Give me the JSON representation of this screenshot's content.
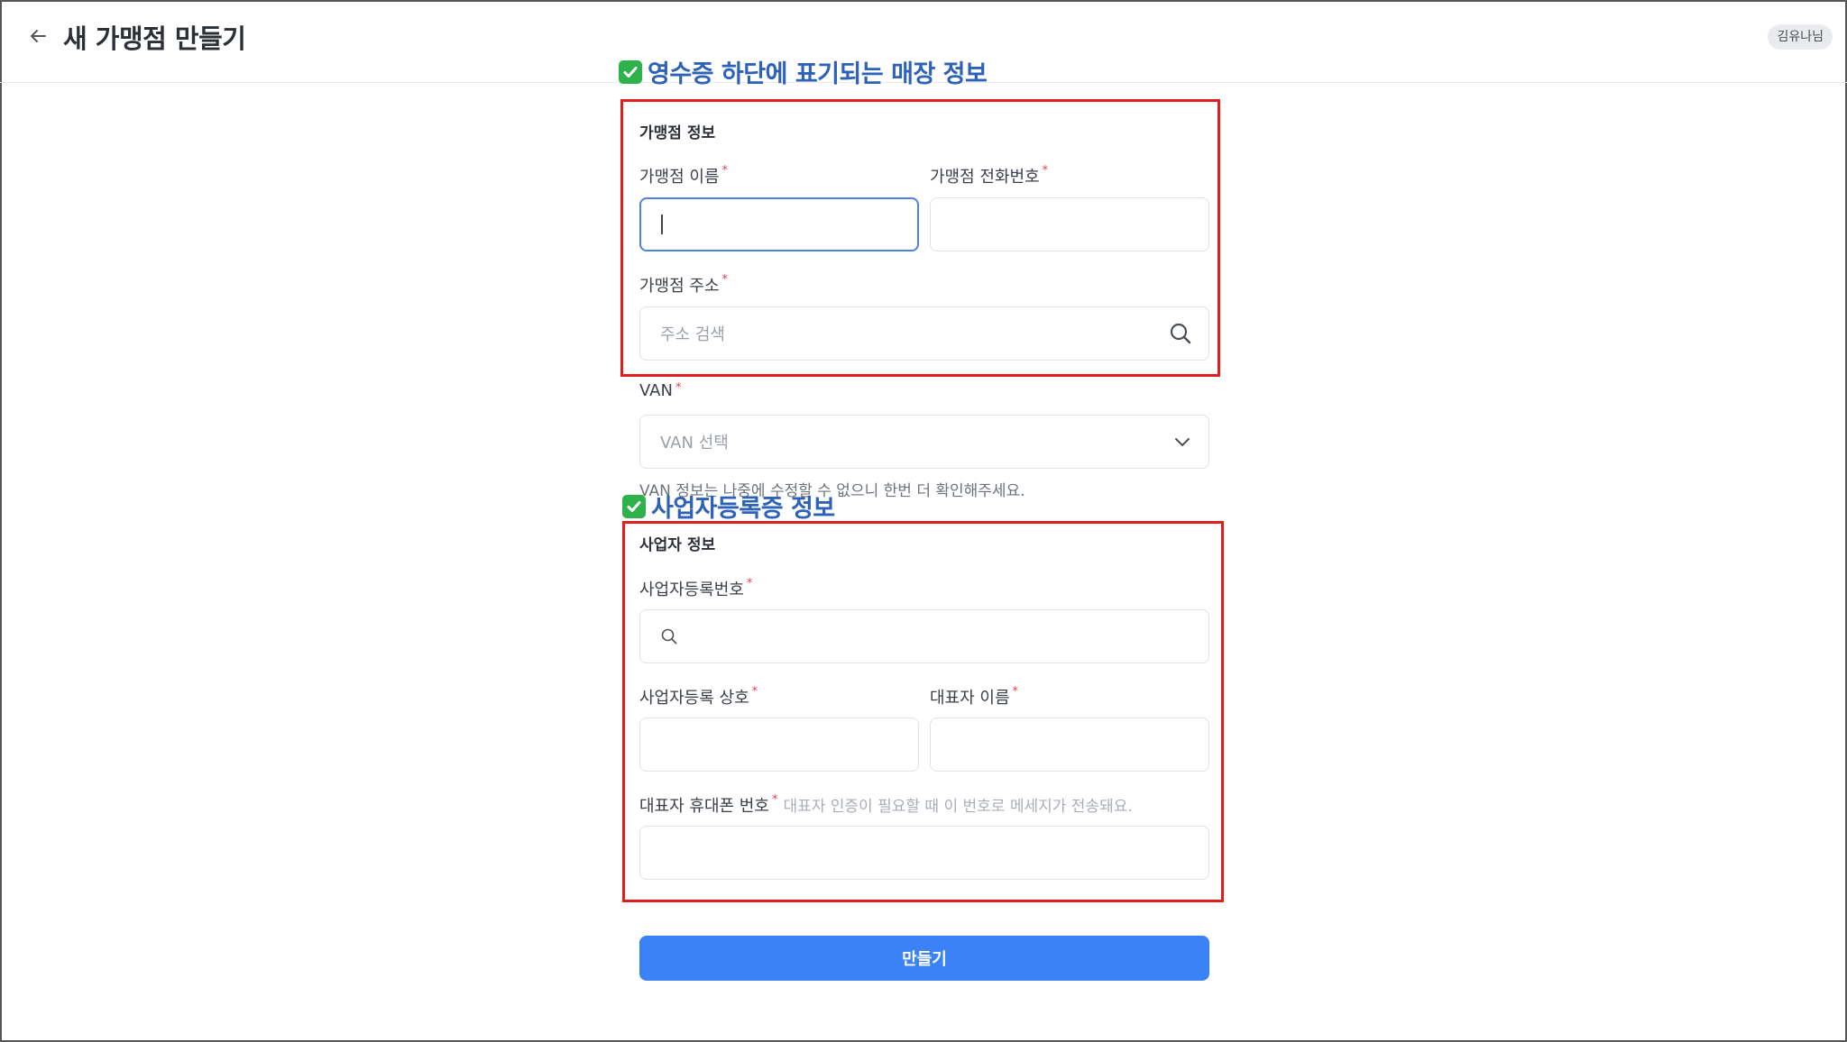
{
  "header": {
    "title": "새 가맹점 만들기",
    "user": "김유나님"
  },
  "annotations": {
    "store_info": "영수증 하단에 표기되는 매장 정보",
    "business_info": "사업자등록증 정보"
  },
  "store_section": {
    "title": "가맹점 정보",
    "name_label": "가맹점 이름",
    "phone_label": "가맹점 전화번호",
    "address_label": "가맹점 주소",
    "address_placeholder": "주소 검색"
  },
  "van": {
    "label": "VAN",
    "placeholder": "VAN 선택",
    "help": "VAN 정보는 나중에 수정할 수 없으니 한번 더 확인해주세요."
  },
  "business_section": {
    "title": "사업자 정보",
    "reg_number_label": "사업자등록번호",
    "trade_name_label": "사업자등록 상호",
    "rep_name_label": "대표자 이름",
    "rep_phone_label": "대표자 휴대폰 번호",
    "rep_phone_hint": "대표자 인증이 필요할 때 이 번호로 메세지가 전송돼요."
  },
  "required_mark": "*",
  "submit_label": "만들기",
  "colors": {
    "primary": "#3b82f6",
    "annotation_text": "#2e62b8",
    "annotation_box": "#e01e1e",
    "required": "#e8414b"
  }
}
